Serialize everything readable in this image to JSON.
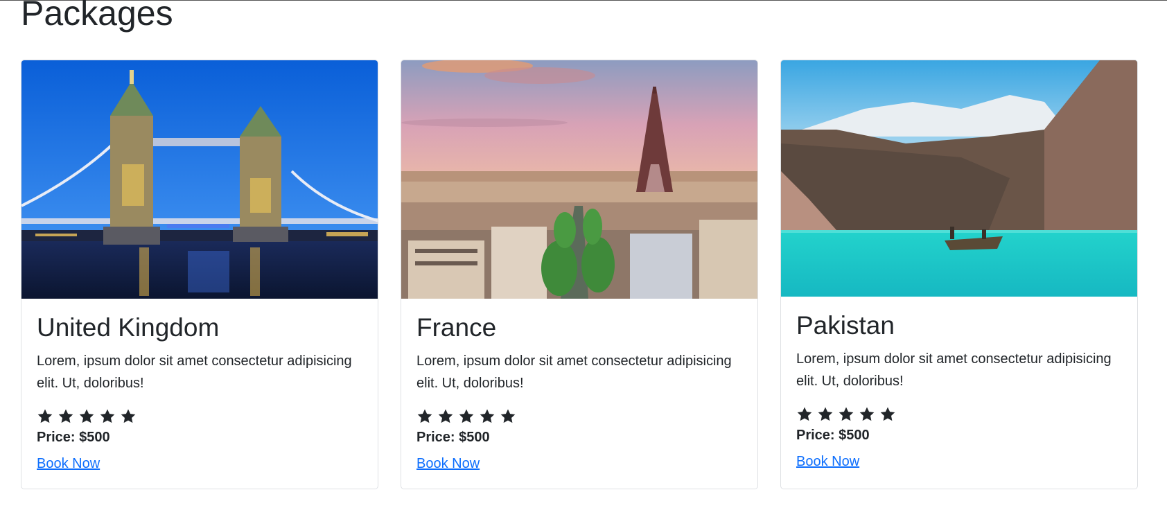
{
  "section": {
    "title": "Packages"
  },
  "cards": [
    {
      "title": "United Kingdom",
      "text": "Lorem, ipsum dolor sit amet consectetur adipisicing elit. Ut, doloribus!",
      "rating": 5,
      "price_label": "Price:",
      "price_value": "$500",
      "link": "Book Now",
      "image_subject": "tower-bridge-at-night"
    },
    {
      "title": "France",
      "text": "Lorem, ipsum dolor sit amet consectetur adipisicing elit. Ut, doloribus!",
      "rating": 5,
      "price_label": "Price:",
      "price_value": "$500",
      "link": "Book Now",
      "image_subject": "paris-eiffel-tower-skyline"
    },
    {
      "title": "Pakistan",
      "text": "Lorem, ipsum dolor sit amet consectetur adipisicing elit. Ut, doloribus!",
      "rating": 5,
      "price_label": "Price:",
      "price_value": "$500",
      "link": "Book Now",
      "image_subject": "turquoise-lake-mountains-boat"
    }
  ],
  "colors": {
    "link": "#0d6efd",
    "text": "#212529",
    "card_border": "#dfe1e4"
  }
}
